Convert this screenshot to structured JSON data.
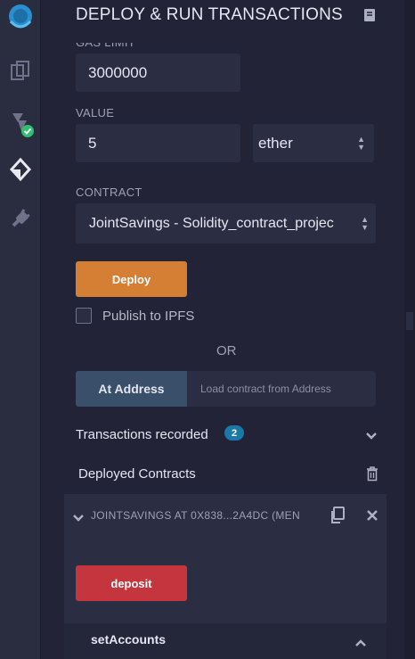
{
  "header": {
    "title": "DEPLOY & RUN TRANSACTIONS"
  },
  "gas_limit": {
    "label": "GAS LIMIT",
    "value": "3000000"
  },
  "value": {
    "label": "VALUE",
    "amount": "5",
    "unit": "ether"
  },
  "contract": {
    "label": "CONTRACT",
    "selected": "JointSavings - Solidity_contract_projec"
  },
  "deploy": {
    "label": "Deploy",
    "publish_label": "Publish to IPFS"
  },
  "or_label": "OR",
  "at_address": {
    "button": "At Address",
    "placeholder": "Load contract from Address"
  },
  "transactions": {
    "label": "Transactions recorded",
    "count": "2"
  },
  "deployed": {
    "label": "Deployed Contracts",
    "instance": {
      "name": "JOINTSAVINGS AT 0X838...2A4DC (MEN",
      "functions": [
        {
          "label": "deposit"
        },
        {
          "label": "setAccounts"
        }
      ]
    }
  },
  "colors": {
    "accent_orange": "#d57f34",
    "deposit_red": "#c4353d",
    "badge_blue": "#1a79a8",
    "check_green": "#2fbf71"
  },
  "icons": [
    "remix-logo-icon",
    "file-explorer-icon",
    "compiler-icon",
    "check-badge-icon",
    "deploy-icon",
    "plugin-icon",
    "docs-icon",
    "trash-icon",
    "chevron-down-icon",
    "copy-icon",
    "close-icon",
    "chevron-up-icon"
  ]
}
